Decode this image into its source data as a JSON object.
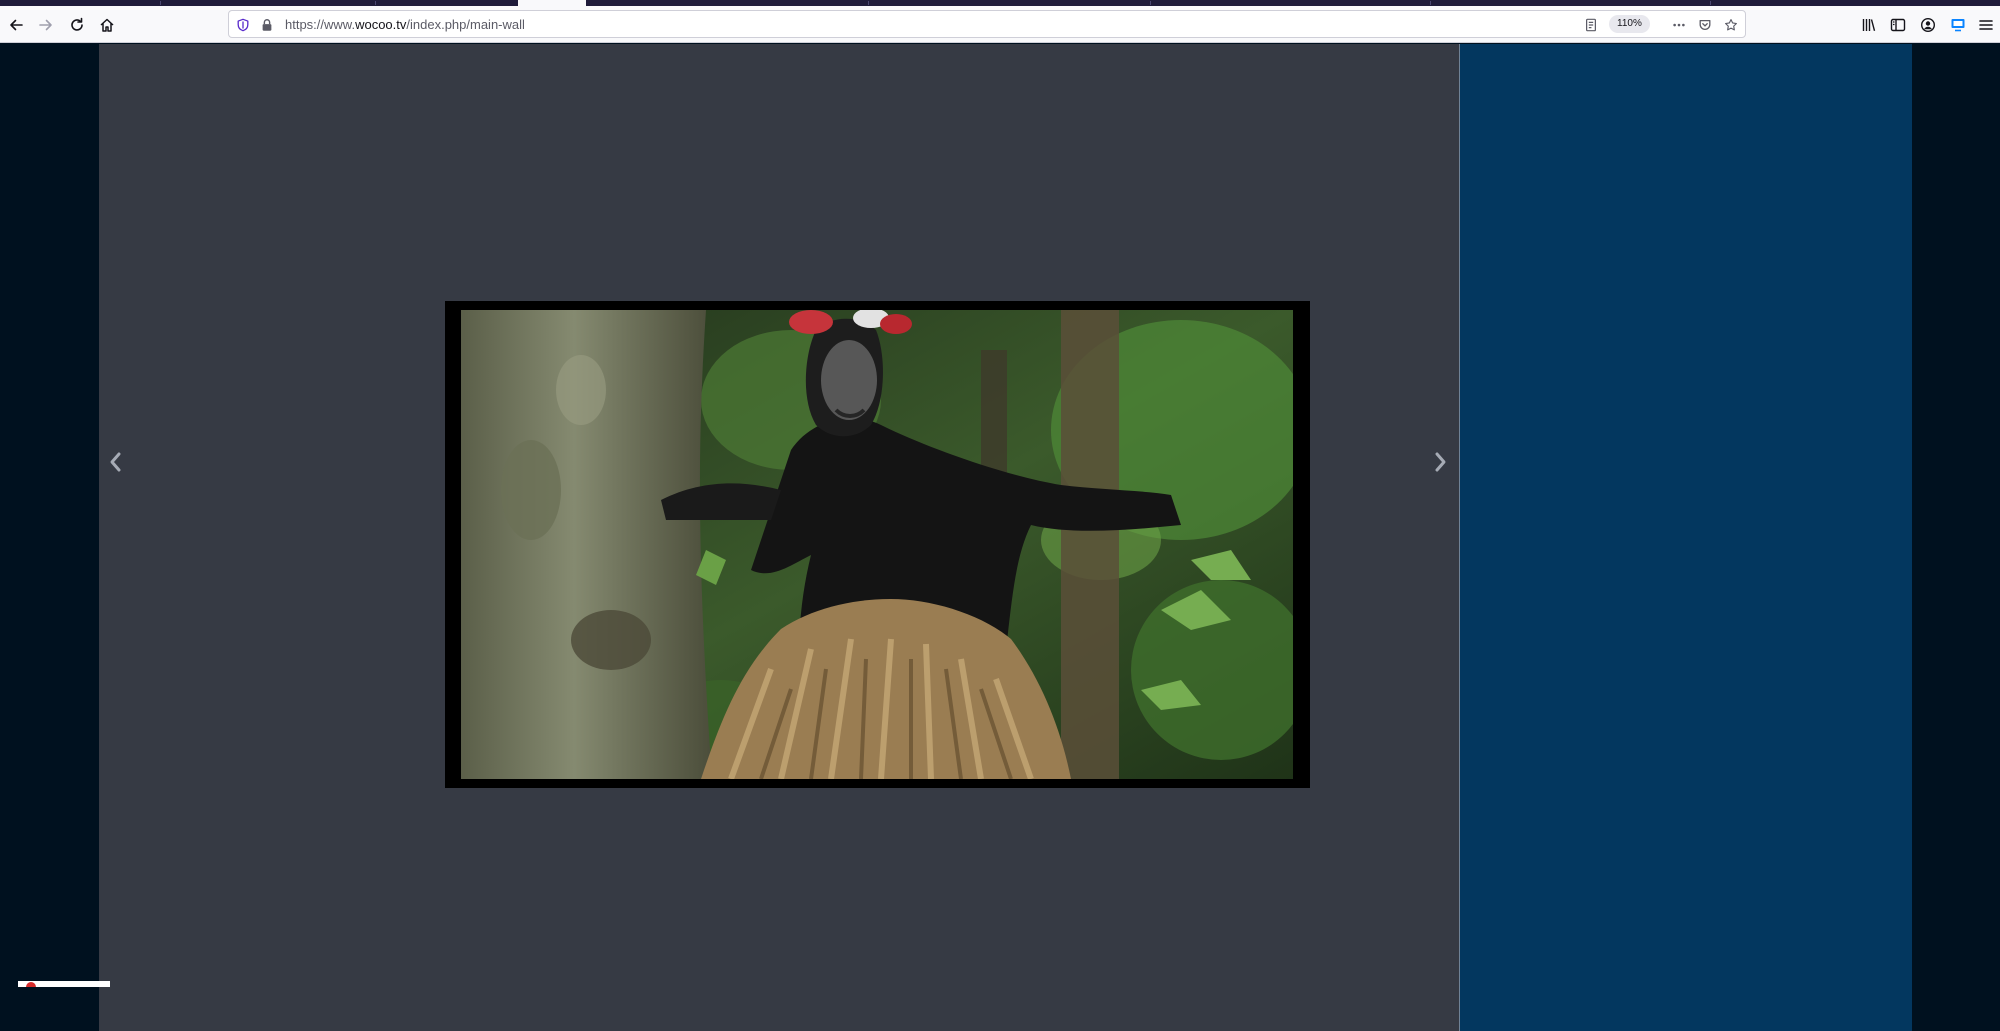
{
  "browser": {
    "url_scheme": "https://www.",
    "url_host": "wocoo.tv",
    "url_path": "/index.php/main-wall",
    "zoom": "110%",
    "icons": {
      "back": "back-arrow-icon",
      "forward": "forward-arrow-icon",
      "reload": "reload-icon",
      "home": "home-icon",
      "tracking": "shield-icon",
      "lock": "lock-icon",
      "reader": "reader-view-icon",
      "more": "more-actions-icon",
      "pocket": "pocket-icon",
      "bookmark": "star-icon",
      "library": "library-icon",
      "sidebar": "sidebar-icon",
      "account": "account-icon",
      "extension": "extension-icon",
      "menu": "hamburger-menu-icon"
    }
  },
  "page": {
    "colors": {
      "background": "#00111f",
      "main_panel": "#363a44",
      "side_panel": "#03375f",
      "arrow": "#a6abb5"
    },
    "media": {
      "icon": "video-thumbnail",
      "description": "masked-dancer-in-forest-scene"
    },
    "gallery": {
      "prev_icon": "chevron-left-icon",
      "next_icon": "chevron-right-icon"
    }
  }
}
